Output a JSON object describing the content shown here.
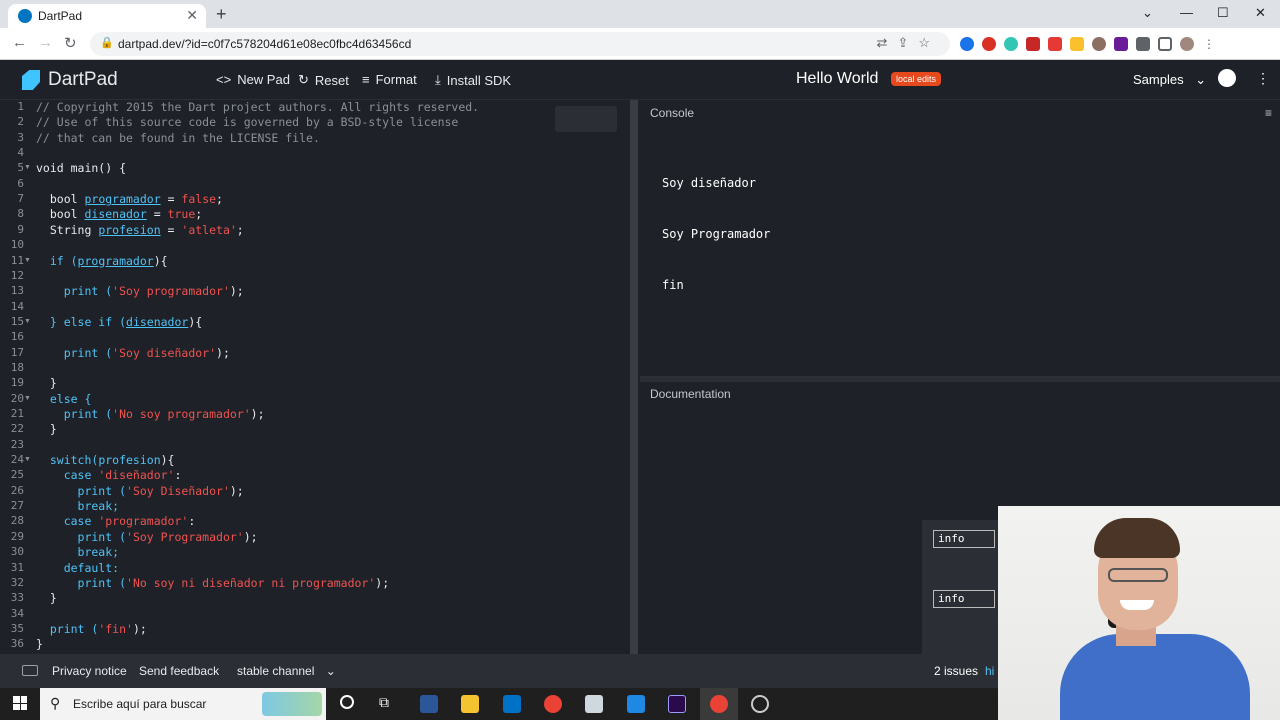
{
  "browser": {
    "tab_title": "DartPad",
    "url": "dartpad.dev/?id=c0f7c578204d61e08ec0fbc4d63456cd"
  },
  "header": {
    "brand": "DartPad",
    "new_pad": "New Pad",
    "reset": "Reset",
    "format": "Format",
    "install_sdk": "Install SDK",
    "title": "Hello World",
    "badge": "local edits",
    "samples": "Samples"
  },
  "editor": {
    "line_numbers": [
      "1",
      "2",
      "3",
      "4",
      "5",
      "6",
      "7",
      "8",
      "9",
      "10",
      "11",
      "12",
      "13",
      "14",
      "15",
      "16",
      "17",
      "18",
      "19",
      "20",
      "21",
      "22",
      "23",
      "24",
      "25",
      "26",
      "27",
      "28",
      "29",
      "30",
      "31",
      "32",
      "33",
      "34",
      "35",
      "36"
    ],
    "lines": {
      "l1": "// Copyright 2015 the Dart project authors. All rights reserved.",
      "l2": "// Use of this source code is governed by a BSD-style license",
      "l3": "// that can be found in the LICENSE file.",
      "l5a": "void main() {",
      "l7a": "  bool ",
      "l7b": "programador",
      "l7c": " = ",
      "l7d": "false",
      "l7e": ";",
      "l8a": "  bool ",
      "l8b": "disenador",
      "l8c": " = ",
      "l8d": "true",
      "l8e": ";",
      "l9a": "  String ",
      "l9b": "profesion",
      "l9c": " = ",
      "l9d": "'atleta'",
      "l9e": ";",
      "l11a": "  if (",
      "l11b": "programador",
      "l11c": "){",
      "l13a": "    print (",
      "l13b": "'Soy programador'",
      "l13c": ");",
      "l15a": "  } else if (",
      "l15b": "disenador",
      "l15c": "){",
      "l17a": "    print (",
      "l17b": "'Soy diseñador'",
      "l17c": ");",
      "l19": "  }",
      "l20": "  else {",
      "l21a": "    print (",
      "l21b": "'No soy programador'",
      "l21c": ");",
      "l22": "  }",
      "l24a": "  switch(",
      "l24b": "profesion",
      "l24c": "){",
      "l25a": "    case ",
      "l25b": "'diseñador'",
      "l25c": ":",
      "l26a": "      print (",
      "l26b": "'Soy Diseñador'",
      "l26c": ");",
      "l27": "      break;",
      "l28a": "    case ",
      "l28b": "'programador'",
      "l28c": ":",
      "l29a": "      print (",
      "l29b": "'Soy Programador'",
      "l29c": ");",
      "l30": "      break;",
      "l31": "    default:",
      "l32a": "      print (",
      "l32b": "'No soy ni diseñador ni programador'",
      "l32c": ");",
      "l33": "  }",
      "l35a": "  print (",
      "l35b": "'fin'",
      "l35c": ");",
      "l36": "}"
    }
  },
  "console": {
    "label": "Console",
    "output": [
      "Soy diseñador",
      "Soy Programador",
      "fin"
    ]
  },
  "documentation": {
    "label": "Documentation",
    "info_1": "info",
    "info_2": "info"
  },
  "footer": {
    "privacy": "Privacy notice",
    "feedback": "Send feedback",
    "channel": "stable channel",
    "issues": "2 issues",
    "hide": "hi"
  },
  "taskbar": {
    "search_placeholder": "Escribe aquí para buscar"
  },
  "colors": {
    "accent": "#40c4ff",
    "badge": "#e5491c",
    "string": "#ef5350",
    "keyword": "#4fc3f7"
  }
}
